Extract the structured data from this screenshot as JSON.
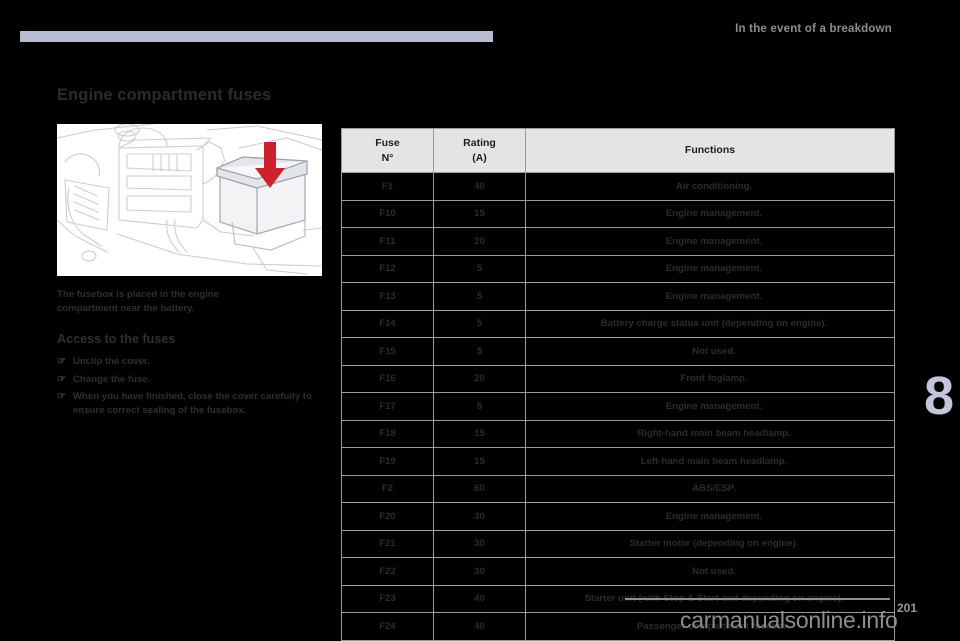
{
  "header": {
    "chapter_title": "In the event of a breakdown"
  },
  "side_tab": {
    "number": "8"
  },
  "left": {
    "page_title": "Engine compartment fuses",
    "illustration_alt": "engine-bay-fusebox-diagram",
    "caption": "The fusebox is placed in the engine compartment near the battery.",
    "section_heading": "Access to the fuses",
    "steps": [
      {
        "marker": "☞",
        "text": "Unclip the cover."
      },
      {
        "marker": "☞",
        "text": "Change the fuse."
      },
      {
        "marker": "☞",
        "text": "When you have finished, close the cover carefully to ensure correct sealing of the fusebox."
      }
    ]
  },
  "table": {
    "headers": {
      "fuse": "Fuse\nN°",
      "fuse_line1": "Fuse",
      "fuse_line2": "N°",
      "rating_line1": "Rating",
      "rating_line2": "(A)",
      "functions": "Functions"
    },
    "rows": [
      {
        "fuse": "F1",
        "rating": "40",
        "function": "Air conditioning."
      },
      {
        "fuse": "F10",
        "rating": "15",
        "function": "Engine management."
      },
      {
        "fuse": "F11",
        "rating": "20",
        "function": "Engine management."
      },
      {
        "fuse": "F12",
        "rating": "5",
        "function": "Engine management."
      },
      {
        "fuse": "F13",
        "rating": "5",
        "function": "Engine management."
      },
      {
        "fuse": "F14",
        "rating": "5",
        "function": "Battery charge status unit (depending on engine)."
      },
      {
        "fuse": "F15",
        "rating": "5",
        "function": "Not used."
      },
      {
        "fuse": "F16",
        "rating": "20",
        "function": "Front foglamp."
      },
      {
        "fuse": "F17",
        "rating": "5",
        "function": "Engine management."
      },
      {
        "fuse": "F18",
        "rating": "15",
        "function": "Right-hand main beam headlamp."
      },
      {
        "fuse": "F19",
        "rating": "15",
        "function": "Left-hand main beam headlamp."
      },
      {
        "fuse": "F2",
        "rating": "60",
        "function": "ABS/ESP."
      },
      {
        "fuse": "F20",
        "rating": "30",
        "function": "Engine management."
      },
      {
        "fuse": "F21",
        "rating": "30",
        "function": "Starter motor (depending on engine)."
      },
      {
        "fuse": "F22",
        "rating": "30",
        "function": "Not used."
      },
      {
        "fuse": "F23",
        "rating": "40",
        "function": "Starter unit (with Stop & Start and depending on engine)."
      },
      {
        "fuse": "F24",
        "rating": "40",
        "function": "Passenger compartment fusebox."
      }
    ]
  },
  "footer": {
    "watermark": "carmanualsonline.info",
    "page_number": "201"
  },
  "colors": {
    "accent_bar": "#b8bcd0",
    "tab_number": "#c3c6db",
    "table_header_bg": "#e4e4e6",
    "table_border": "#9b9b9b",
    "arrow_red": "#cc2229",
    "page_bg": "#000000"
  }
}
